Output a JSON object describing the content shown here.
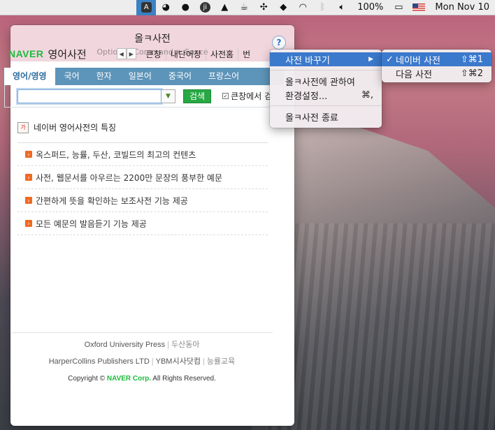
{
  "menubar": {
    "right_text": "100%",
    "clock": "Mon Nov 10",
    "icons": [
      "app-dict-icon",
      "timer-icon",
      "chat-icon",
      "ji-icon",
      "hat-icon",
      "coffee-icon",
      "pinwheel-icon",
      "dropbox-icon",
      "wifi-icon",
      "bluetooth-icon",
      "volume-icon",
      "battery-icon",
      "flag-icon"
    ]
  },
  "popover": {
    "title": "올ㅋ사전",
    "subtitle": "Option + Command + Space",
    "help": "?"
  },
  "naver": {
    "logo": "NAVER",
    "title": "영어사전",
    "links": [
      "큰창",
      "내단어장",
      "사전홈",
      "번"
    ]
  },
  "tabs": [
    "영어/영영",
    "국어",
    "한자",
    "일본어",
    "중국어",
    "프랑스어"
  ],
  "search": {
    "value": "",
    "button": "검색",
    "newwin": "큰창에서 검"
  },
  "features": {
    "heading": "네이버 영어사전의 특징",
    "items": [
      "옥스퍼드, 능률, 두산, 코빌드의 최고의 컨텐츠",
      "사전, 웹문서를 아우르는 2200만 문장의 풍부한 예문",
      "간편하게 뜻을 확인하는 보조사전 기능 제공",
      "모든 예문의 발음듣기 기능 제공"
    ]
  },
  "footer": {
    "line1a": "Oxford University Press",
    "line1b": "두산동아",
    "line2a": "HarperCollins Publishers LTD",
    "line2b": "YBM시사닷컴",
    "line2c": "능률교육",
    "copyright_pre": "Copyright ©",
    "copyright_brand": "NAVER Corp.",
    "copyright_post": "All Rights Reserved."
  },
  "menu": {
    "item1": "사전 바꾸기",
    "item2a": "올ㅋ사전에 관하여",
    "item2b": "환경설정...",
    "item2b_shortcut": "⌘,",
    "item3": "올ㅋ사전 종료"
  },
  "submenu": {
    "item1": "네이버 사전",
    "item1_shortcut": "⇧⌘1",
    "item2": "다음 사전",
    "item2_shortcut": "⇧⌘2"
  },
  "colors": {
    "naver_green": "#1cbb3e",
    "tab_blue": "#5d94b9",
    "menu_highlight": "#3b79cc",
    "bullet_orange": "#ee6a22"
  }
}
